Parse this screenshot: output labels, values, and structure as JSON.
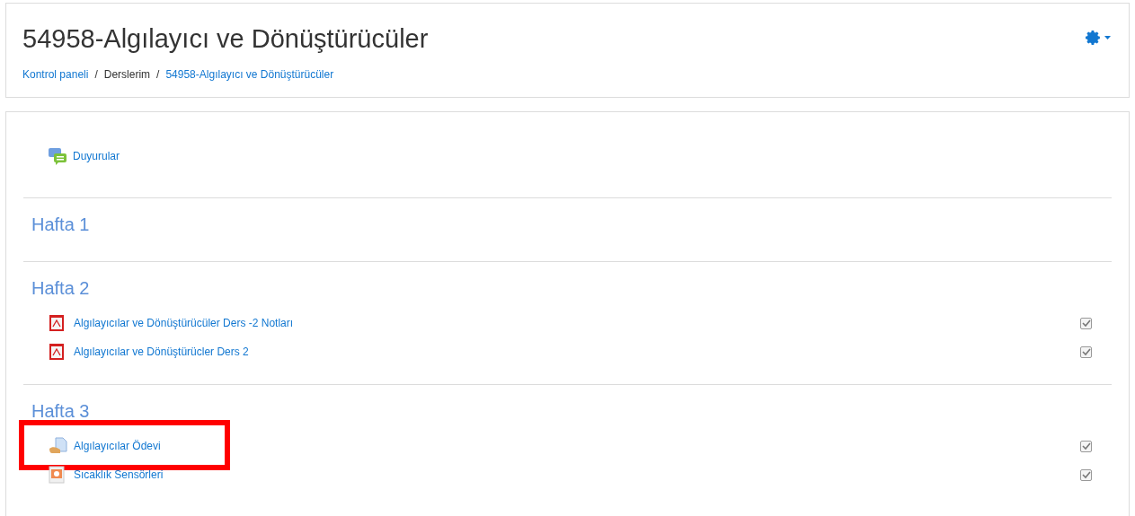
{
  "header": {
    "title": "54958-Algılayıcı ve Dönüştürücüler",
    "breadcrumb": [
      {
        "kind": "link",
        "label": "Kontrol paneli"
      },
      {
        "kind": "separator",
        "label": "/"
      },
      {
        "kind": "text",
        "label": "Derslerim"
      },
      {
        "kind": "separator",
        "label": "/"
      },
      {
        "kind": "link",
        "label": "54958-Algılayıcı ve Dönüştürücüler"
      }
    ]
  },
  "sections": [
    {
      "activities": [
        {
          "kind": "forum",
          "label": "Duyurular",
          "highlighted": false
        }
      ]
    },
    {
      "title": "Hafta 1"
    },
    {
      "title": "Hafta 2",
      "activities": [
        {
          "kind": "pdf",
          "label": "Algılayıcılar ve Dönüştürücüler Ders -2 Notları",
          "completed": true,
          "highlighted": false
        },
        {
          "kind": "pdf",
          "label": "Algılayıcılar ve Dönüştürücler Ders 2",
          "completed": true,
          "highlighted": false
        }
      ]
    },
    {
      "title": "Hafta 3",
      "activities": [
        {
          "kind": "assignment",
          "label": "Algılayıcılar Ödevi",
          "completed": true,
          "highlighted": true
        },
        {
          "kind": "presentation",
          "label": "Sıcaklık Sensörleri",
          "completed": true,
          "highlighted": false
        }
      ]
    }
  ]
}
